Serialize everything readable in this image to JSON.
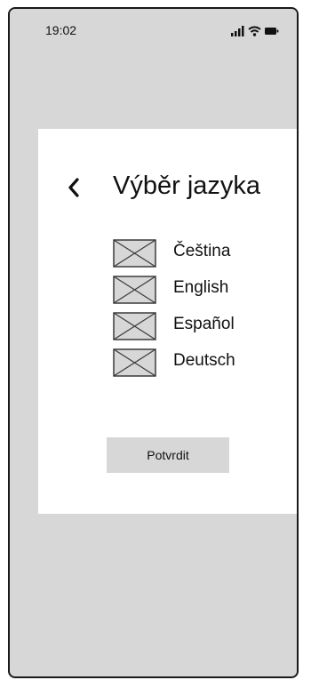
{
  "status_bar": {
    "time": "19:02",
    "icons": [
      "signal-icon",
      "wifi-icon",
      "battery-icon"
    ]
  },
  "screen": {
    "title": "Výběr jazyka",
    "back_icon": "chevron-left-icon",
    "languages": [
      {
        "label": "Čeština",
        "icon": "image-placeholder-icon"
      },
      {
        "label": "English",
        "icon": "image-placeholder-icon"
      },
      {
        "label": "Español",
        "icon": "image-placeholder-icon"
      },
      {
        "label": "Deutsch",
        "icon": "image-placeholder-icon"
      }
    ],
    "confirm_label": "Potvrdit"
  },
  "colors": {
    "background": "#d7d7d7",
    "card": "#ffffff",
    "text": "#111111",
    "button": "#d7d7d7"
  }
}
